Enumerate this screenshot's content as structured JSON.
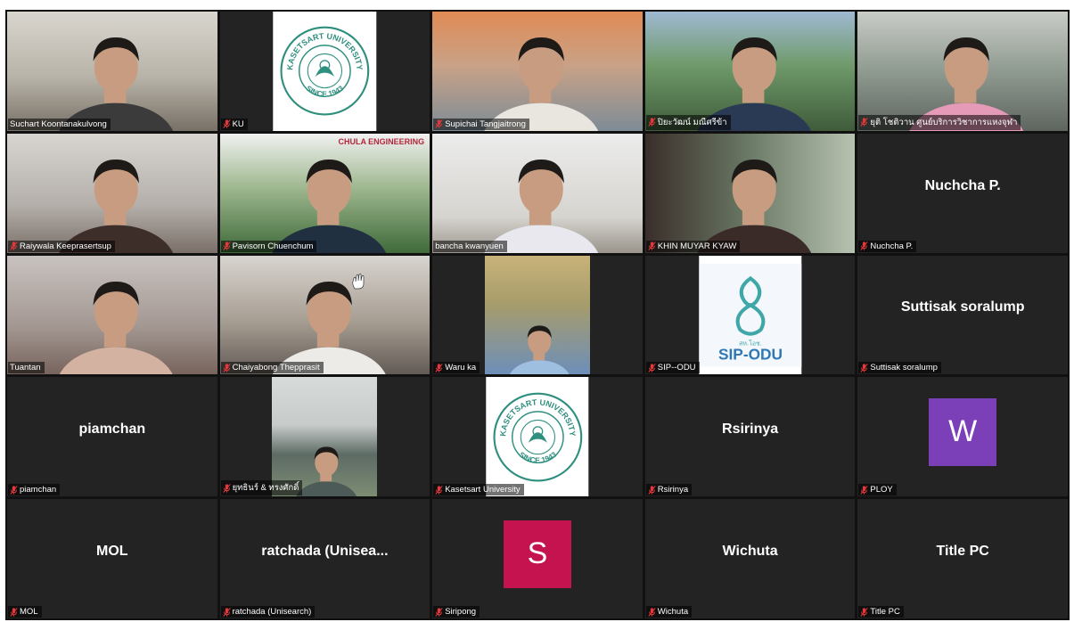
{
  "meeting": {
    "participants": [
      {
        "name": "Suchart Koontanakulvong",
        "display": "",
        "muted": false,
        "type": "video",
        "avatar_letter": "",
        "avatar_color": "",
        "bg": "linear-gradient(180deg,#d9d6cf 0%,#b8b3a8 55%,#777066 100%)",
        "person_color": "#3b3b3b"
      },
      {
        "name": "KU",
        "display": "",
        "muted": true,
        "type": "logo",
        "logo_text": "KASETSART UNIVERSITY",
        "logo_sub": "SINCE 1943",
        "logo_color": "#2f8f7f"
      },
      {
        "name": "Supichai Tangjaitrong",
        "display": "",
        "muted": true,
        "type": "video",
        "bg": "linear-gradient(180deg,#e08a54 0%,#c9a287 45%,#7d8c96 100%)",
        "person_color": "#e9e6df"
      },
      {
        "name": "ปิยะวัฒน์ มณีศรีข้า",
        "display": "",
        "muted": true,
        "type": "video",
        "bg": "linear-gradient(180deg,#9fb9d2 0%,#6f9a6a 45%,#3f5b3a 100%)",
        "person_color": "#2a3a55"
      },
      {
        "name": "ยุติ โชติวาน ศูนย์บริการวิชาการแหงจุฬา",
        "display": "",
        "muted": true,
        "type": "video",
        "bg": "linear-gradient(180deg,#c9ccc7 0%,#8f9a90 50%,#5e655f 100%)",
        "person_color": "#e59ab7"
      },
      {
        "name": "Raiywala Keeprasertsup",
        "display": "",
        "muted": true,
        "type": "video",
        "bg": "linear-gradient(180deg,#d8d5d0 0%,#b4afaa 60%,#7a6f68 100%)",
        "person_color": "#3d2e2a"
      },
      {
        "name": "Pavisorn Chuenchum",
        "display": "",
        "muted": true,
        "type": "video",
        "bg": "linear-gradient(180deg,#f1f1f1 0%,#9fb88f 45%,#3f6a3a 100%)",
        "person_color": "#203040",
        "banner": "CHULA ENGINEERING"
      },
      {
        "name": "bancha kwanyuen",
        "display": "",
        "muted": false,
        "type": "video",
        "active": true,
        "bg": "linear-gradient(180deg,#ececec 0%,#d6d4cf 70%,#9a948c 100%)",
        "person_color": "#e8e8ee"
      },
      {
        "name": "KHIN MUYAR KYAW",
        "display": "",
        "muted": true,
        "type": "video",
        "bg": "linear-gradient(90deg,#3a2e2a 0%,#6b7a66 50%,#b7c2b0 100%)",
        "person_color": "#3a2b28"
      },
      {
        "name": "Nuchcha P.",
        "display": "Nuchcha P.",
        "muted": true,
        "type": "name"
      },
      {
        "name": "Tuantan",
        "display": "",
        "muted": false,
        "type": "video",
        "bg": "linear-gradient(180deg,#c8c2bf 0%,#a39792 60%,#77645d 100%)",
        "person_color": "#d4b2a1"
      },
      {
        "name": "Chaiyabong Thepprasit",
        "display": "",
        "muted": true,
        "type": "video",
        "hand": true,
        "bg": "linear-gradient(180deg,#d8d4cf 0%,#a79e93 55%,#625b55 100%)",
        "person_color": "#ecebe7"
      },
      {
        "name": "Waru ka",
        "display": "",
        "muted": true,
        "type": "photo",
        "bg": "linear-gradient(180deg,#c8b37a 0%,#a79c6a 40%,#6d8fb9 100%)",
        "person_color": "#9fbfe0"
      },
      {
        "name": "SIP--ODU",
        "display": "",
        "muted": true,
        "type": "logo",
        "logo_text": "SIP-ODU",
        "logo_sub": "สห.โอช.",
        "logo_color": "#3fa7a8"
      },
      {
        "name": "Suttisak soralump",
        "display": "Suttisak soralump",
        "muted": true,
        "type": "name"
      },
      {
        "name": "piamchan",
        "display": "piamchan",
        "muted": true,
        "type": "name"
      },
      {
        "name": "ยุทธินร์ & ทรงศักดิ์",
        "display": "",
        "muted": true,
        "type": "photo",
        "bg": "linear-gradient(180deg,#d7dbd9 0%,#c7ccca 40%,#5d6b65 65%,#7d8d73 100%)",
        "person_color": "#4c5a58"
      },
      {
        "name": "Kasetsart University",
        "display": "",
        "muted": true,
        "type": "logo",
        "logo_text": "KASETSART UNIVERSITY",
        "logo_sub": "SINCE 1943",
        "logo_color": "#2f8f7f"
      },
      {
        "name": "Rsirinya",
        "display": "Rsirinya",
        "muted": true,
        "type": "name"
      },
      {
        "name": "PLOY",
        "display": "",
        "muted": true,
        "type": "avatar",
        "avatar_letter": "W",
        "avatar_color": "#7b3fb8"
      },
      {
        "name": "MOL",
        "display": "MOL",
        "muted": true,
        "type": "name"
      },
      {
        "name": "ratchada (Unisearch)",
        "display": "ratchada (Unisea...",
        "muted": true,
        "type": "name"
      },
      {
        "name": "Siripong",
        "display": "",
        "muted": true,
        "type": "avatar",
        "avatar_letter": "S",
        "avatar_color": "#c4134f"
      },
      {
        "name": "Wichuta",
        "display": "Wichuta",
        "muted": true,
        "type": "name"
      },
      {
        "name": "Title PC",
        "display": "Title PC",
        "muted": true,
        "type": "name"
      }
    ]
  }
}
